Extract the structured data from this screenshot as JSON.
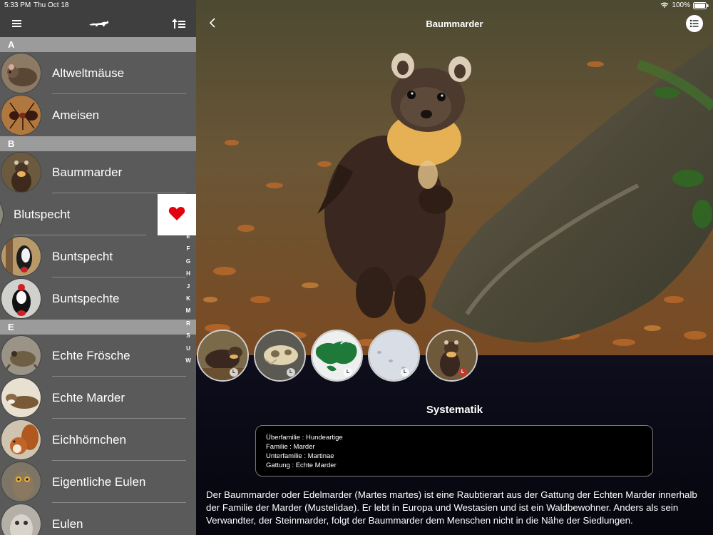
{
  "status": {
    "time": "5:33 PM",
    "date": "Thu Oct 18",
    "battery": "100%"
  },
  "sidebar": {
    "menu_icon": "hamburger-icon",
    "logo_icon": "marten-logo-icon",
    "sort_icon": "sort-list-icon",
    "sections": [
      {
        "letter": "A",
        "items": [
          {
            "name": "Altweltmäuse"
          },
          {
            "name": "Ameisen"
          }
        ]
      },
      {
        "letter": "B",
        "items": [
          {
            "name": "Baummarder"
          },
          {
            "name": "Blutspecht",
            "swiped": true
          },
          {
            "name": "Buntspecht"
          },
          {
            "name": "Buntspechte"
          }
        ]
      },
      {
        "letter": "E",
        "items": [
          {
            "name": "Echte Frösche"
          },
          {
            "name": "Echte Marder"
          },
          {
            "name": "Eichhörnchen"
          },
          {
            "name": "Eigentliche Eulen"
          },
          {
            "name": "Eulen"
          }
        ]
      }
    ],
    "favorite_icon": "heart-icon",
    "favorite_color": "#e3000f",
    "alpha_index": [
      "E",
      "F",
      "G",
      "H",
      "J",
      "K",
      "M",
      "R",
      "S",
      "U",
      "W"
    ]
  },
  "detail": {
    "title": "Baummarder",
    "back_icon": "chevron-left-icon",
    "list_icon": "list-icon",
    "thumbnails": [
      {
        "badge": "L",
        "subject": "marten-photo"
      },
      {
        "badge": "L",
        "subject": "skull-photo"
      },
      {
        "badge": "L",
        "subject": "distribution-map"
      },
      {
        "badge": "L",
        "subject": "snow-tracks-photo"
      },
      {
        "badge": "L",
        "subject": "marten-photo",
        "active": true
      }
    ],
    "section_title": "Systematik",
    "taxonomy": [
      "Überfamilie : Hundeartige",
      "Familie : Marder",
      "Unterfamilie : Martinae",
      "Gattung : Echte Marder"
    ],
    "description": "Der Baummarder oder Edelmarder (Martes martes) ist eine Raubtierart aus der Gattung der Echten Marder innerhalb der Familie der Marder (Mustelidae). Er lebt in Europa und Westasien und ist ein Waldbewohner. Anders als sein Verwandter, der Steinmarder, folgt der Baummarder dem Menschen nicht in die Nähe der Siedlungen."
  }
}
